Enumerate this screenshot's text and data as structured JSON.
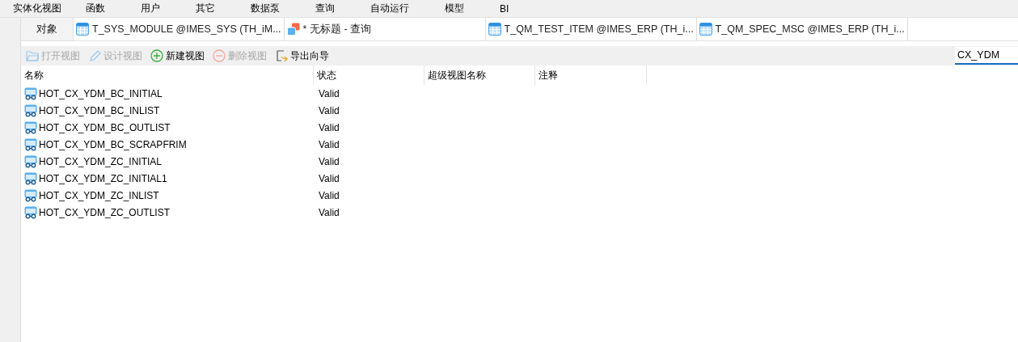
{
  "menu": [
    {
      "label": "实体化视图"
    },
    {
      "label": "函数"
    },
    {
      "label": "用户"
    },
    {
      "label": "其它"
    },
    {
      "label": "数据泵"
    },
    {
      "label": "查询"
    },
    {
      "label": "自动运行"
    },
    {
      "label": "模型"
    },
    {
      "label": "BI"
    }
  ],
  "tabs": [
    {
      "label": "对象",
      "kind": "plain",
      "selected": true
    },
    {
      "label": "T_SYS_MODULE @IMES_SYS (TH_iM...",
      "kind": "table",
      "selected": false
    },
    {
      "label": "* 无标题 - 查询",
      "kind": "query",
      "selected": false
    },
    {
      "label": "T_QM_TEST_ITEM @IMES_ERP (TH_i...",
      "kind": "table",
      "selected": false
    },
    {
      "label": "T_QM_SPEC_MSC @IMES_ERP (TH_i...",
      "kind": "table",
      "selected": false
    }
  ],
  "toolbar": [
    {
      "label": "打开视图",
      "kind": "open",
      "disabled": true
    },
    {
      "label": "设计视图",
      "kind": "design",
      "disabled": true
    },
    {
      "label": "新建视图",
      "kind": "new",
      "disabled": false
    },
    {
      "label": "删除视图",
      "kind": "delete",
      "disabled": true
    },
    {
      "label": "导出向导",
      "kind": "export",
      "disabled": false
    }
  ],
  "search": {
    "value": "CX_YDM"
  },
  "table": {
    "columns": [
      "名称",
      "状态",
      "超级视图名称",
      "注释"
    ],
    "rows": [
      [
        "HOT_CX_YDM_BC_INITIAL",
        "Valid"
      ],
      [
        "HOT_CX_YDM_BC_INLIST",
        "Valid"
      ],
      [
        "HOT_CX_YDM_BC_OUTLIST",
        "Valid"
      ],
      [
        "HOT_CX_YDM_BC_SCRAPFRIM",
        "Valid"
      ],
      [
        "HOT_CX_YDM_ZC_INITIAL",
        "Valid"
      ],
      [
        "HOT_CX_YDM_ZC_INITIAL1",
        "Valid"
      ],
      [
        "HOT_CX_YDM_ZC_INLIST",
        "Valid"
      ],
      [
        "HOT_CX_YDM_ZC_OUTLIST",
        "Valid"
      ]
    ]
  }
}
